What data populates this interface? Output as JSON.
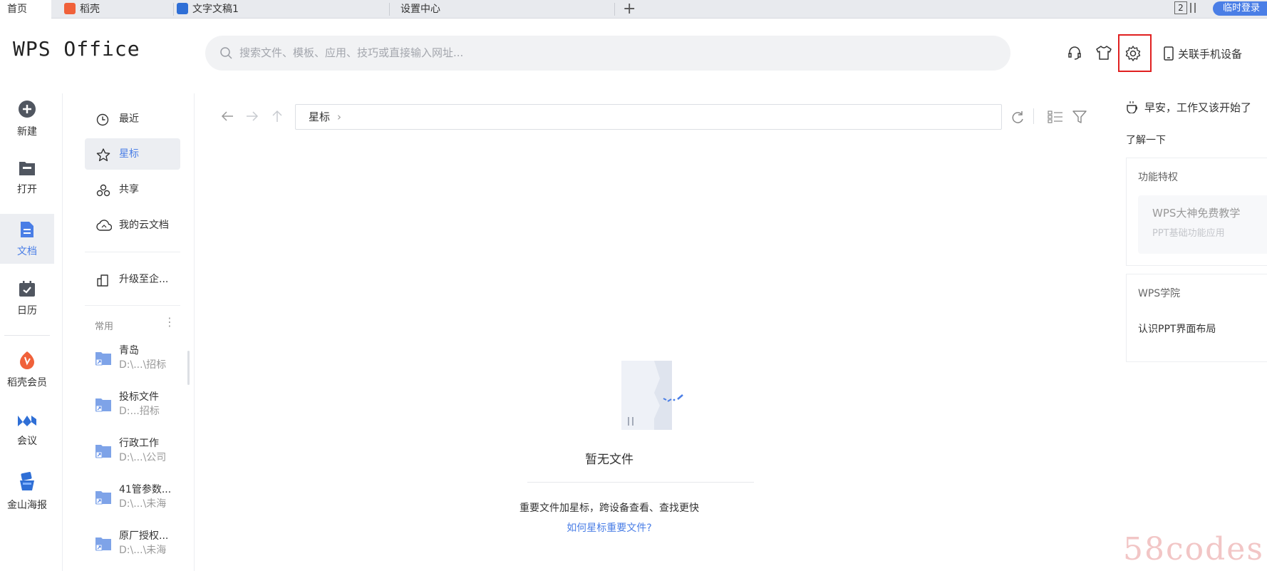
{
  "tabs": [
    {
      "label": "首页"
    },
    {
      "label": "稻壳"
    },
    {
      "label": "文字文稿1"
    },
    {
      "label": "设置中心"
    }
  ],
  "tabbar": {
    "window_count": "2",
    "login_label": "临时登录"
  },
  "header": {
    "logo": "WPS Office",
    "search_placeholder": "搜索文件、模板、应用、技巧或直接输入网址...",
    "link_phone": "关联手机设备"
  },
  "rail": {
    "new": "新建",
    "open": "打开",
    "docs": "文档",
    "calendar": "日历",
    "docer_vip": "稻壳会员",
    "meeting": "会议",
    "poster": "金山海报"
  },
  "nav": {
    "recent": "最近",
    "starred": "星标",
    "shared": "共享",
    "cloud": "我的云文档",
    "upgrade": "升级至企...",
    "common_header": "常用"
  },
  "favorites": [
    {
      "name": "青岛",
      "path": "D:\\...\\招标"
    },
    {
      "name": "投标文件",
      "path": "D:...招标"
    },
    {
      "name": "行政工作",
      "path": "D:\\...\\公司"
    },
    {
      "name": "41管参数...",
      "path": "D:\\...\\未海"
    },
    {
      "name": "原厂授权...",
      "path": "D:\\...\\未海"
    }
  ],
  "main": {
    "breadcrumb": "星标",
    "empty_title": "暂无文件",
    "empty_desc": "重要文件加星标，跨设备查看、查找更快",
    "empty_link": "如何星标重要文件?"
  },
  "right_panel": {
    "greeting": "早安，工作又该开始了",
    "learn_more": "了解一下",
    "card1_title": "功能特权",
    "card1_item_title": "WPS大神免费教学",
    "card1_item_sub": "PPT基础功能应用",
    "card2_title": "WPS学院",
    "card2_item": "认识PPT界面布局"
  },
  "watermark": "58codes",
  "colors": {
    "accent": "#4a7ee6",
    "highlight_box": "#e02020",
    "docer_orange": "#f0613a"
  }
}
